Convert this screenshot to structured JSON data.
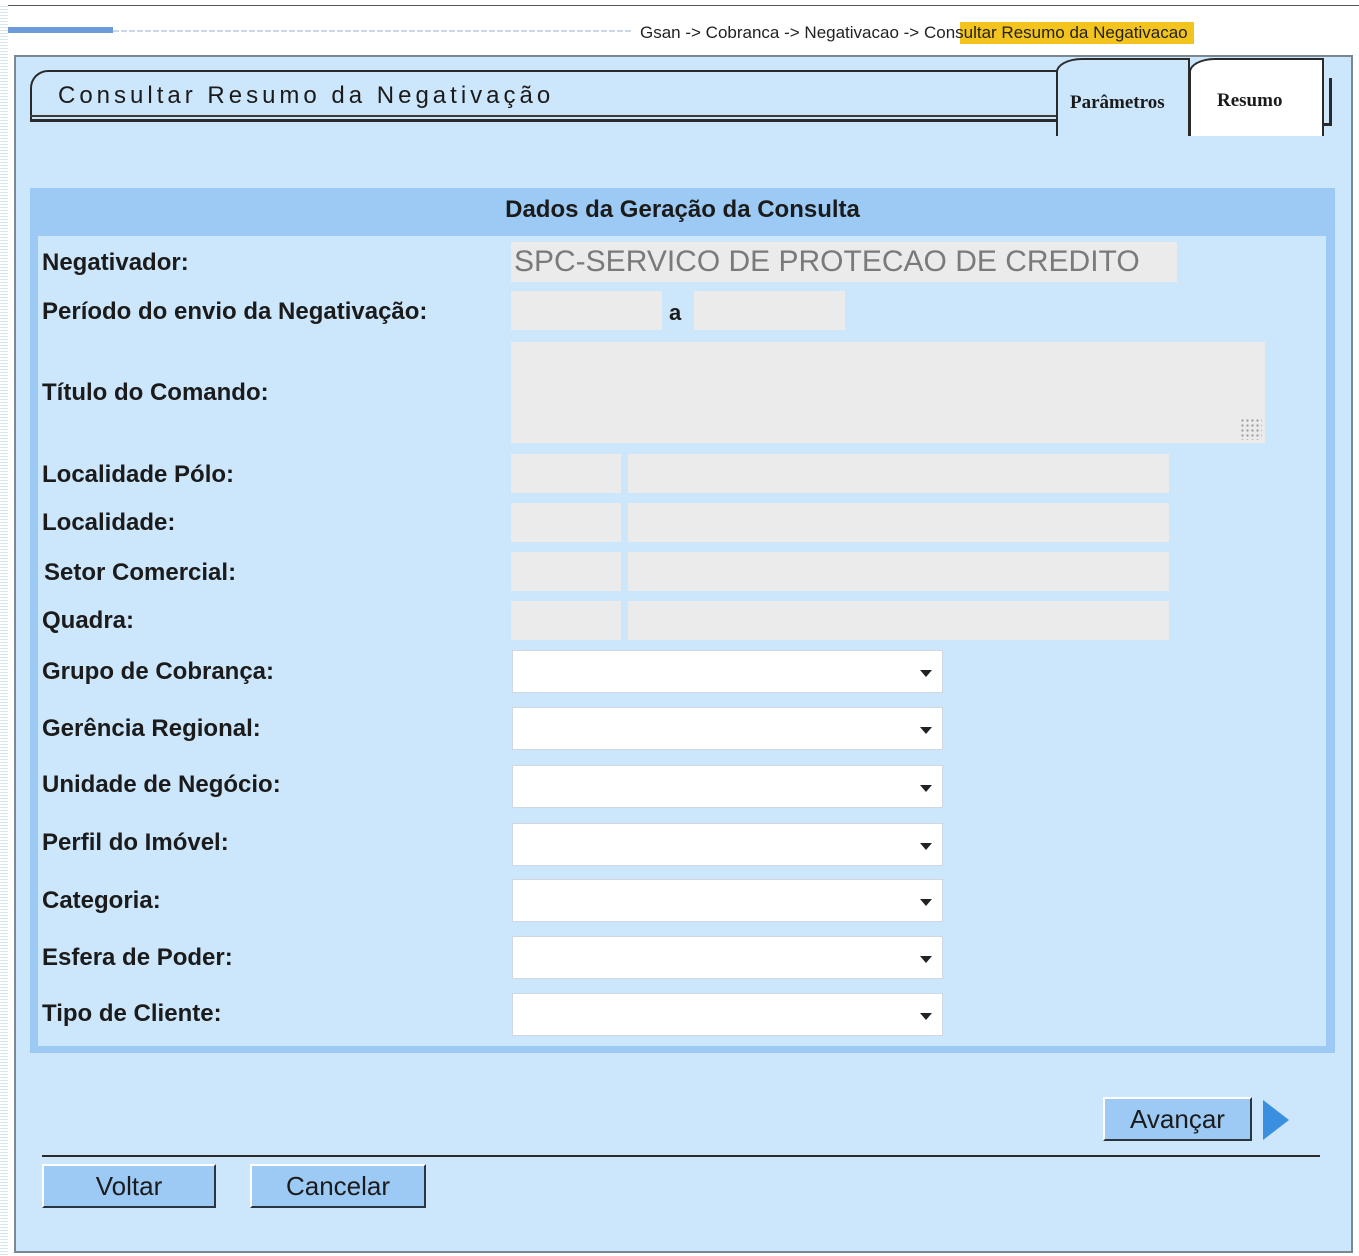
{
  "breadcrumb": {
    "path": "Gsan -> Cobranca -> Negativacao",
    "current": " -> Consultar Resumo da Negativacao"
  },
  "page": {
    "title": "Consultar Resumo da Negativação"
  },
  "tabs": {
    "parametros": "Parâmetros",
    "resumo": "Resumo"
  },
  "form": {
    "header": "Dados da Geração da Consulta",
    "negativador_label": "Negativador:",
    "negativador_value": "SPC-SERVICO DE PROTECAO DE CREDITO",
    "periodo_label": "Período do envio da Negativação:",
    "periodo_sep": "a",
    "periodo_inicio": "",
    "periodo_fim": "",
    "titulo_label": "Título do Comando:",
    "titulo_value": "",
    "localidade_polo_label": "Localidade Pólo:",
    "localidade_label": "Localidade:",
    "setor_label": "Setor Comercial:",
    "quadra_label": "Quadra:",
    "grupo_label": "Grupo de Cobrança:",
    "gerencia_label": "Gerência Regional:",
    "unidade_label": "Unidade de Negócio:",
    "perfil_label": "Perfil do Imóvel:",
    "categoria_label": "Categoria:",
    "esfera_label": "Esfera de Poder:",
    "tipo_cliente_label": "Tipo de Cliente:",
    "grupo_value": "",
    "gerencia_value": "",
    "unidade_value": "",
    "perfil_value": "",
    "categoria_value": "",
    "esfera_value": "",
    "tipo_cliente_value": ""
  },
  "buttons": {
    "avancar": "Avançar",
    "voltar": "Voltar",
    "cancelar": "Cancelar"
  },
  "icons": {
    "next": "play-arrow-icon",
    "dropdown": "chevron-down-icon"
  },
  "colors": {
    "panel": "#cce6fb",
    "frame": "#9ccaf5",
    "breadcrumb_highlight": "#f3c41e",
    "arrow": "#3a8fe0"
  }
}
